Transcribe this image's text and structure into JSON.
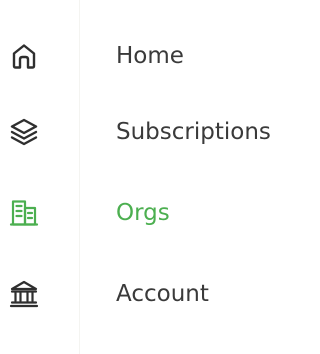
{
  "colors": {
    "text": "#3a3a3a",
    "active": "#4caf50",
    "icon": "#2f2f2f",
    "divider": "#f4f4f1"
  },
  "nav": {
    "items": [
      {
        "label": "Home",
        "icon": "home-icon",
        "active": false
      },
      {
        "label": "Subscriptions",
        "icon": "layers-icon",
        "active": false
      },
      {
        "label": "Orgs",
        "icon": "building-icon",
        "active": true
      },
      {
        "label": "Account",
        "icon": "bank-icon",
        "active": false
      }
    ]
  }
}
